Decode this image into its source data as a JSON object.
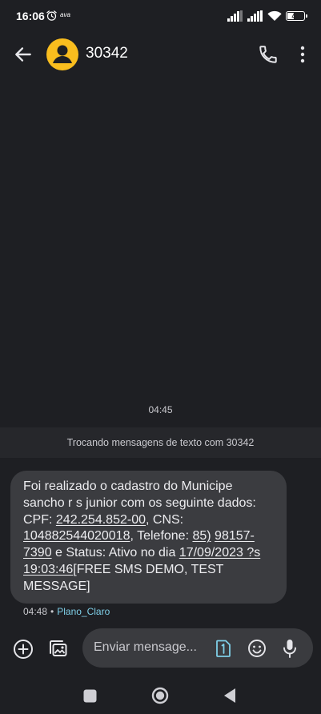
{
  "status_bar": {
    "time": "16:06",
    "carrier_logo": "ava",
    "battery": "41",
    "battery_level": 0.41
  },
  "header": {
    "title": "30342"
  },
  "conversation": {
    "timestamp": "04:45",
    "info_banner": "Trocando mensagens de texto com 30342",
    "message": {
      "p1": "Foi realizado o cadastro do Municipe sancho r s junior com os seguinte dados: CPF: ",
      "cpf": "242.254.852-00",
      "p2": ", CNS: ",
      "cns": "104882544020018",
      "p3": ", Telefone: ",
      "phone_a": "85)",
      "p4": " ",
      "phone_b": "98157-7390",
      "p5": " e Status: Ativo no dia ",
      "datetime": "17/09/2023 ?s 19:03:46",
      "p6": "[FREE SMS DEMO, TEST MESSAGE]"
    },
    "message_time": "04:48",
    "separator": "•",
    "sim_name": "Plano_Claro"
  },
  "composer": {
    "placeholder": "Enviar mensage..."
  },
  "colors": {
    "background": "#1e1f23",
    "bubble": "#3b3c40",
    "avatar": "#f9bd1e",
    "accent": "#7fcfe8"
  },
  "icons": [
    "alarm-icon",
    "signal-icon",
    "wifi-icon",
    "battery-icon",
    "back-arrow-icon",
    "person-icon",
    "phone-icon",
    "more-vert-icon",
    "add-icon",
    "gallery-icon",
    "sim-icon",
    "emoji-icon",
    "mic-icon",
    "recents-icon",
    "home-icon",
    "nav-back-icon"
  ]
}
